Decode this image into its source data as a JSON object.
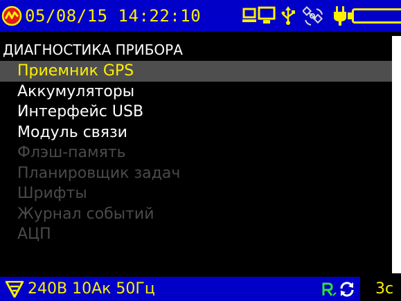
{
  "colors": {
    "bar_background": "#0000c8",
    "accent_yellow": "#fff000",
    "selected_row": "#4e4e4e",
    "disabled_text": "#4a4a4a",
    "logo_red": "#e01a1a"
  },
  "status_bar": {
    "datetime": "05/08/15 14:22:10",
    "icons": [
      "device-logo-icon",
      "pc-connection-icon",
      "usb-icon",
      "satellite-icon",
      "power-plug-icon",
      "battery-icon"
    ]
  },
  "screen": {
    "title": "ДИАГНОСТИКА ПРИБОРА"
  },
  "menu": {
    "items": [
      {
        "label": "Приемник GPS",
        "state": "selected"
      },
      {
        "label": "Аккумуляторы",
        "state": "enabled"
      },
      {
        "label": "Интерфейс USB",
        "state": "enabled"
      },
      {
        "label": "Модуль связи",
        "state": "enabled"
      },
      {
        "label": "Флэш-память",
        "state": "disabled"
      },
      {
        "label": "Планировщик задач",
        "state": "disabled"
      },
      {
        "label": "Шрифты",
        "state": "disabled"
      },
      {
        "label": "Журнал событий",
        "state": "disabled"
      },
      {
        "label": "АЦП",
        "state": "disabled"
      }
    ]
  },
  "bottom_bar": {
    "measurement": "240В 10Ак 50Гц",
    "right_label": "3с",
    "icons": [
      "filter-icon",
      "rx-signal-icon",
      "sync-icon"
    ]
  }
}
